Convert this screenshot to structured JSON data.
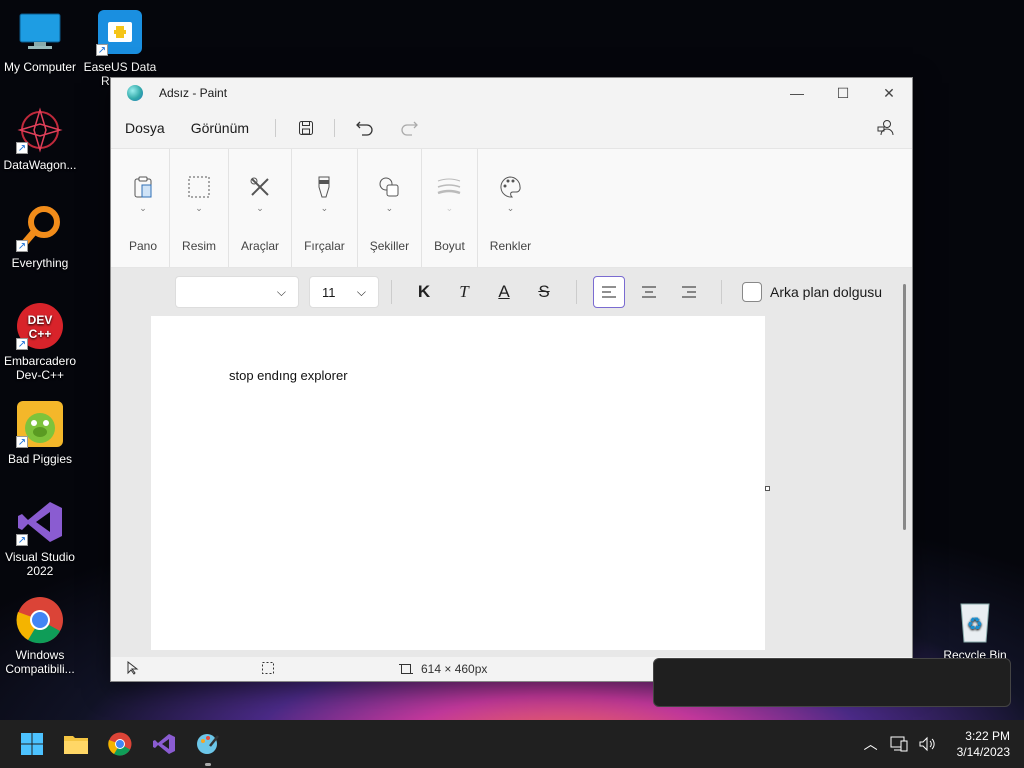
{
  "desktop": {
    "icons": [
      {
        "label": "My Computer"
      },
      {
        "label": "EaseUS Data Reco..."
      },
      {
        "label": "DataWagon..."
      },
      {
        "label": "Everything"
      },
      {
        "label": "Embarcadero Dev-C++"
      },
      {
        "label": "Bad Piggies"
      },
      {
        "label": "Visual Studio 2022"
      },
      {
        "label": "Windows Compatibili..."
      },
      {
        "label": "Recycle Bin"
      }
    ]
  },
  "window": {
    "title": "Adsız - Paint",
    "menu": {
      "file": "Dosya",
      "view": "Görünüm"
    },
    "ribbon": {
      "groups": [
        {
          "label": "Pano",
          "icon": "clipboard-icon"
        },
        {
          "label": "Resim",
          "icon": "select-rectangle-icon"
        },
        {
          "label": "Araçlar",
          "icon": "tools-icon"
        },
        {
          "label": "Fırçalar",
          "icon": "brush-icon"
        },
        {
          "label": "Şekiller",
          "icon": "shapes-icon"
        },
        {
          "label": "Boyut",
          "icon": "line-size-icon"
        },
        {
          "label": "Renkler",
          "icon": "palette-icon"
        }
      ]
    },
    "textbar": {
      "font_value": "",
      "size_value": "11",
      "bold": "K",
      "italic": "T",
      "underline": "A",
      "strike": "S",
      "background_fill_label": "Arka plan dolgusu"
    },
    "canvas": {
      "text": "stop endıng explorer"
    },
    "status": {
      "canvas_size": "614 × 460px"
    }
  },
  "taskbar": {
    "apps": [
      "start-icon",
      "file-explorer-icon",
      "chrome-icon",
      "visual-studio-icon",
      "paint-icon"
    ],
    "clock": {
      "time": "3:22 PM",
      "date": "3/14/2023"
    }
  },
  "colors": {
    "accent": "#7a6bd1",
    "taskbar": "#202020"
  }
}
